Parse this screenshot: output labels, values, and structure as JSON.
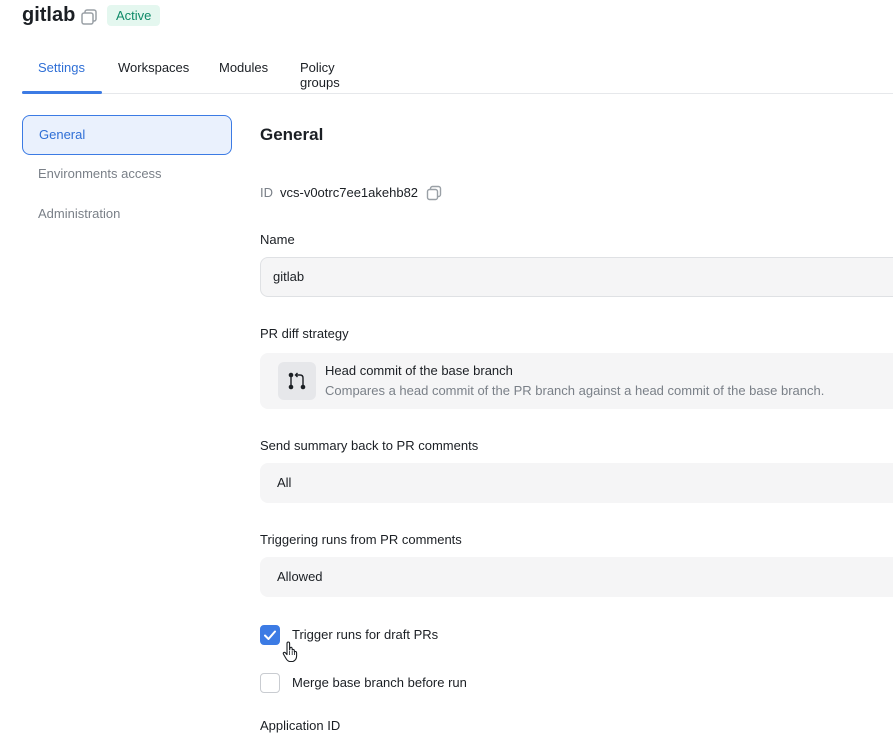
{
  "header": {
    "title": "gitlab",
    "status": "Active"
  },
  "tabs": [
    {
      "label": "Settings",
      "active": true
    },
    {
      "label": "Workspaces",
      "active": false
    },
    {
      "label": "Modules",
      "active": false
    },
    {
      "label": "Policy groups",
      "active": false
    }
  ],
  "sidebar": {
    "items": [
      {
        "label": "General",
        "active": true
      },
      {
        "label": "Environments access",
        "active": false
      },
      {
        "label": "Administration",
        "active": false
      }
    ]
  },
  "general": {
    "title": "General",
    "id_label": "ID",
    "id_value": "vcs-v0otrc7ee1akehb82",
    "name_label": "Name",
    "name_value": "gitlab",
    "pr_diff_label": "PR diff strategy",
    "pr_diff_title": "Head commit of the base branch",
    "pr_diff_desc": "Compares a head commit of the PR branch against a head commit of the base branch.",
    "summary_label": "Send summary back to PR comments",
    "summary_value": "All",
    "triggering_label": "Triggering runs from PR comments",
    "triggering_value": "Allowed",
    "draft_label": "Trigger runs for draft PRs",
    "draft_checked": true,
    "merge_label": "Merge base branch before run",
    "merge_checked": false,
    "next_label_partial": "Application ID"
  },
  "colors": {
    "accent": "#3c7be4",
    "badge_text": "#0f8a68",
    "badge_bg": "#e4f7ef"
  },
  "icons": [
    "copy-icon",
    "git-compare-icon",
    "check-icon",
    "hand-pointer-icon"
  ]
}
